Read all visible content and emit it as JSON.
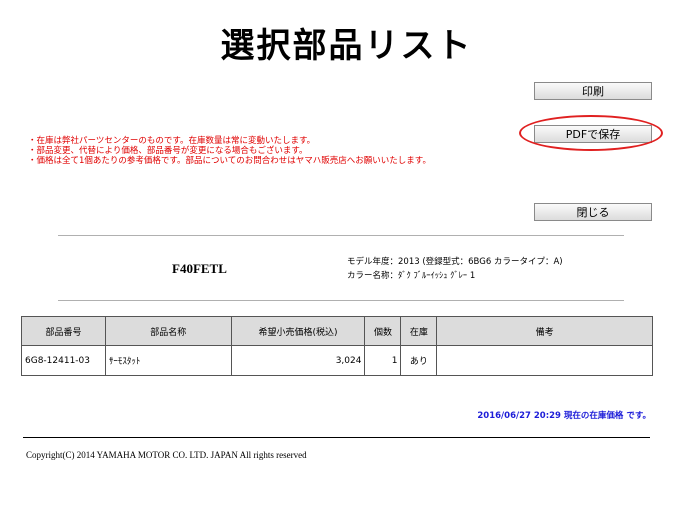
{
  "page": {
    "title": "選択部品リスト"
  },
  "buttons": {
    "print_label": "印刷",
    "pdf_label": "PDFで保存",
    "close_label": "閉じる"
  },
  "notes": [
    "・在庫は弊社パーツセンターのものです。在庫数量は常に変動いたします。",
    "・部品変更、代替により価格、部品番号が変更になる場合もございます。",
    "・価格は全て1個あたりの参考価格です。部品についてのお問合わせはヤマハ販売店へお願いいたします。"
  ],
  "model": {
    "name": "F40FETL",
    "year_line": "モデル年度：2013 (登録型式：6BG6 カラータイプ：A)",
    "color_line": "カラー名称：ﾀﾞｸ ﾌﾞﾙｰｲｯｼｭ ｸﾞﾚｰ 1"
  },
  "table": {
    "headers": [
      "部品番号",
      "部品名称",
      "希望小売価格(税込)",
      "個数",
      "在庫",
      "備考"
    ],
    "rows": [
      {
        "part_number": "6G8-12411-03",
        "part_name": "ｻｰﾓｽﾀｯﾄ",
        "price": "3,024",
        "quantity": "1",
        "stock": "あり",
        "remarks": ""
      }
    ]
  },
  "status": {
    "timestamp": "2016/06/27 20:29 現在の在庫価格 です。"
  },
  "footer": {
    "copyright": "Copyright(C) 2014 YAMAHA MOTOR CO. LTD. JAPAN All rights reserved"
  },
  "colors": {
    "notes": "#e00000",
    "timestamp": "#1c1cd8",
    "highlight_ellipse": "#e02020",
    "table_header_bg": "#dcdcdc"
  }
}
